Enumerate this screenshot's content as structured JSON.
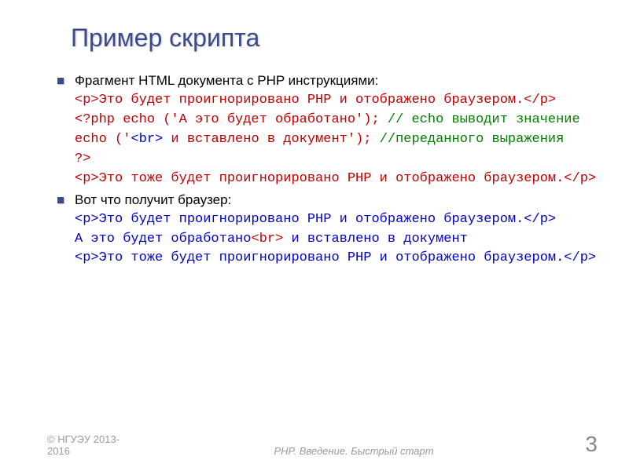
{
  "title": "Пример скрипта",
  "bullets": {
    "b1_intro": "Фрагмент HTML документа с PHP инструкциями:",
    "b1_line1": "<p>Это будет проигнорировано PHP и отображено браузером.</p>",
    "b1_line2_a": "<?php echo ('А это будет обработано'); ",
    "b1_line2_b": "// echo выводит значение",
    "b1_line3_a": "   echo ('",
    "b1_line3_b": "<br>",
    "b1_line3_c": " и вставлено в документ'); ",
    "b1_line3_d": "//переданного выражения",
    "b1_line4": " ?>",
    "b1_line5": "<p>Это тоже будет проигнорировано PHP и отображено браузером.</p>",
    "b2_intro": "Вот что получит браузер:",
    "b2_line1": "<p>Это будет проигнорировано PHP и отображено браузером.</p>",
    "b2_line2_a": "А это будет обработано",
    "b2_line2_b": "<br>",
    "b2_line2_c": " и вставлено в документ",
    "b2_line3": "<p>Это тоже будет проигнорировано PHP и отображено браузером.</p>"
  },
  "footer": {
    "left_line1": "© НГУЭУ 2013-",
    "left_line2": "2016",
    "center": "PHP. Введение. Быстрый старт",
    "page": "3"
  }
}
